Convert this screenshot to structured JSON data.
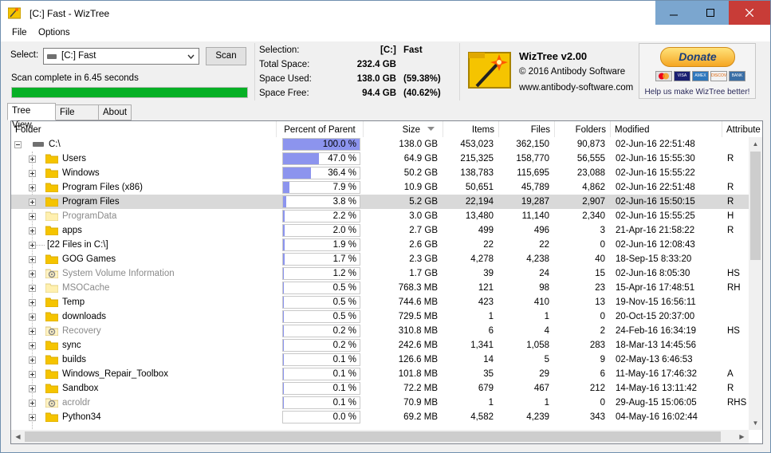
{
  "window": {
    "title": "[C:] Fast  - WizTree"
  },
  "menu": {
    "file": "File",
    "options": "Options"
  },
  "scan": {
    "select_label": "Select:",
    "selected_drive": "[C:] Fast",
    "scan_button": "Scan",
    "status": "Scan complete in 6.45 seconds",
    "progress_percent": 100
  },
  "info": {
    "selection_label": "Selection:",
    "selection_drive": "[C:]",
    "selection_name": "Fast",
    "total_label": "Total Space:",
    "total_value": "232.4 GB",
    "used_label": "Space Used:",
    "used_value": "138.0 GB",
    "used_pct": "(59.38%)",
    "free_label": "Space Free:",
    "free_value": "94.4 GB",
    "free_pct": "(40.62%)"
  },
  "about": {
    "app": "WizTree v2.00",
    "copyright": "© 2016 Antibody Software",
    "url": "www.antibody-software.com"
  },
  "donate": {
    "button": "Donate",
    "text": "Help us make WizTree better!",
    "cards": [
      "VISA",
      "AMEX",
      "DISCOVER",
      "BANK"
    ]
  },
  "tabs": [
    {
      "label": "Tree View",
      "active": true
    },
    {
      "label": "File View"
    },
    {
      "label": "About"
    }
  ],
  "columns": {
    "folder": "Folder",
    "percent": "Percent of Parent",
    "size": "Size",
    "items": "Items",
    "files": "Files",
    "folders": "Folders",
    "modified": "Modified",
    "attributes": "Attribute"
  },
  "rows": [
    {
      "name": "C:\\",
      "type": "drive",
      "pct": 100.0,
      "pct_label": "100.0 %",
      "size": "138.0 GB",
      "items": "453,023",
      "files": "362,150",
      "folders": "90,873",
      "modified": "02-Jun-16 22:51:48",
      "attr": ""
    },
    {
      "name": "Users",
      "type": "folder",
      "pct": 47.0,
      "pct_label": "47.0 %",
      "size": "64.9 GB",
      "items": "215,325",
      "files": "158,770",
      "folders": "56,555",
      "modified": "02-Jun-16 15:55:30",
      "attr": "R"
    },
    {
      "name": "Windows",
      "type": "folder",
      "pct": 36.4,
      "pct_label": "36.4 %",
      "size": "50.2 GB",
      "items": "138,783",
      "files": "115,695",
      "folders": "23,088",
      "modified": "02-Jun-16 15:55:22",
      "attr": ""
    },
    {
      "name": "Program Files (x86)",
      "type": "folder",
      "pct": 7.9,
      "pct_label": "7.9 %",
      "size": "10.9 GB",
      "items": "50,651",
      "files": "45,789",
      "folders": "4,862",
      "modified": "02-Jun-16 22:51:48",
      "attr": "R"
    },
    {
      "name": "Program Files",
      "type": "folder",
      "pct": 3.8,
      "pct_label": "3.8 %",
      "size": "5.2 GB",
      "items": "22,194",
      "files": "19,287",
      "folders": "2,907",
      "modified": "02-Jun-16 15:50:15",
      "attr": "R",
      "selected": true
    },
    {
      "name": "ProgramData",
      "type": "hidden",
      "pct": 2.2,
      "pct_label": "2.2 %",
      "size": "3.0 GB",
      "items": "13,480",
      "files": "11,140",
      "folders": "2,340",
      "modified": "02-Jun-16 15:55:25",
      "attr": "H"
    },
    {
      "name": "apps",
      "type": "folder",
      "pct": 2.0,
      "pct_label": "2.0 %",
      "size": "2.7 GB",
      "items": "499",
      "files": "496",
      "folders": "3",
      "modified": "21-Apr-16 21:58:22",
      "attr": "R"
    },
    {
      "name": "[22 Files in C:\\]",
      "type": "files",
      "pct": 1.9,
      "pct_label": "1.9 %",
      "size": "2.6 GB",
      "items": "22",
      "files": "22",
      "folders": "0",
      "modified": "02-Jun-16 12:08:43",
      "attr": ""
    },
    {
      "name": "GOG Games",
      "type": "folder",
      "pct": 1.7,
      "pct_label": "1.7 %",
      "size": "2.3 GB",
      "items": "4,278",
      "files": "4,238",
      "folders": "40",
      "modified": "18-Sep-15 8:33:20",
      "attr": ""
    },
    {
      "name": "System Volume Information",
      "type": "system",
      "pct": 1.2,
      "pct_label": "1.2 %",
      "size": "1.7 GB",
      "items": "39",
      "files": "24",
      "folders": "15",
      "modified": "02-Jun-16 8:05:30",
      "attr": "HS"
    },
    {
      "name": "MSOCache",
      "type": "hidden",
      "pct": 0.5,
      "pct_label": "0.5 %",
      "size": "768.3 MB",
      "items": "121",
      "files": "98",
      "folders": "23",
      "modified": "15-Apr-16 17:48:51",
      "attr": "RH"
    },
    {
      "name": "Temp",
      "type": "folder",
      "pct": 0.5,
      "pct_label": "0.5 %",
      "size": "744.6 MB",
      "items": "423",
      "files": "410",
      "folders": "13",
      "modified": "19-Nov-15 16:56:11",
      "attr": ""
    },
    {
      "name": "downloads",
      "type": "folder",
      "pct": 0.5,
      "pct_label": "0.5 %",
      "size": "729.5 MB",
      "items": "1",
      "files": "1",
      "folders": "0",
      "modified": "20-Oct-15 20:37:00",
      "attr": ""
    },
    {
      "name": "Recovery",
      "type": "system",
      "pct": 0.2,
      "pct_label": "0.2 %",
      "size": "310.8 MB",
      "items": "6",
      "files": "4",
      "folders": "2",
      "modified": "24-Feb-16 16:34:19",
      "attr": "HS"
    },
    {
      "name": "sync",
      "type": "folder",
      "pct": 0.2,
      "pct_label": "0.2 %",
      "size": "242.6 MB",
      "items": "1,341",
      "files": "1,058",
      "folders": "283",
      "modified": "18-Mar-13 14:45:56",
      "attr": ""
    },
    {
      "name": "builds",
      "type": "folder",
      "pct": 0.1,
      "pct_label": "0.1 %",
      "size": "126.6 MB",
      "items": "14",
      "files": "5",
      "folders": "9",
      "modified": "02-May-13 6:46:53",
      "attr": ""
    },
    {
      "name": "Windows_Repair_Toolbox",
      "type": "folder",
      "pct": 0.1,
      "pct_label": "0.1 %",
      "size": "101.8 MB",
      "items": "35",
      "files": "29",
      "folders": "6",
      "modified": "11-May-16 17:46:32",
      "attr": "A"
    },
    {
      "name": "Sandbox",
      "type": "folder",
      "pct": 0.1,
      "pct_label": "0.1 %",
      "size": "72.2 MB",
      "items": "679",
      "files": "467",
      "folders": "212",
      "modified": "14-May-16 13:11:42",
      "attr": "R"
    },
    {
      "name": "acroldr",
      "type": "system",
      "pct": 0.1,
      "pct_label": "0.1 %",
      "size": "70.9 MB",
      "items": "1",
      "files": "1",
      "folders": "0",
      "modified": "29-Aug-15 15:06:05",
      "attr": "RHS"
    },
    {
      "name": "Python34",
      "type": "folder",
      "pct": 0.0,
      "pct_label": "0.0 %",
      "size": "69.2 MB",
      "items": "4,582",
      "files": "4,239",
      "folders": "343",
      "modified": "04-May-16 16:02:44",
      "attr": ""
    }
  ],
  "colors": {
    "bar": "#8c94ee",
    "selected_row": "#d9d9d9",
    "progress": "#06b025",
    "folder": "#f5c400",
    "close": "#c83c37",
    "titlebtn": "#7ba6cf"
  }
}
